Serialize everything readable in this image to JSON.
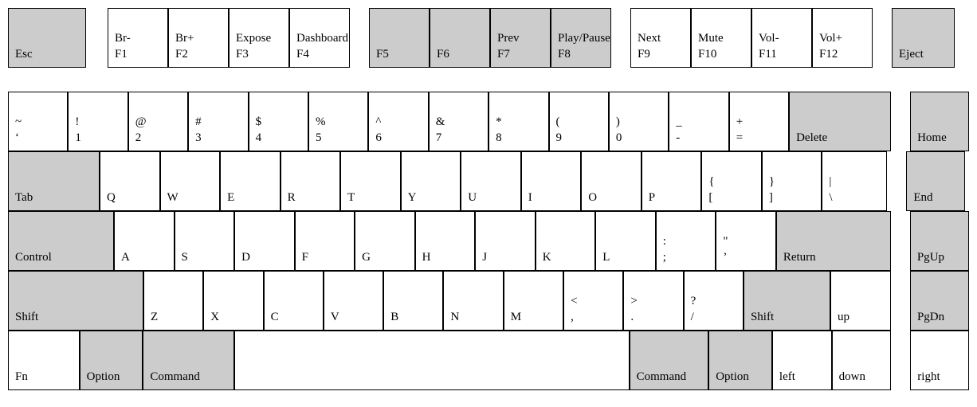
{
  "functionRow": {
    "esc": "Esc",
    "keys": [
      {
        "top": "Br-",
        "bottom": "F1",
        "shaded": false
      },
      {
        "top": "Br+",
        "bottom": "F2",
        "shaded": false
      },
      {
        "top": "Expose",
        "bottom": "F3",
        "shaded": false
      },
      {
        "top": "Dashboard",
        "bottom": "F4",
        "shaded": false
      },
      {
        "top": "",
        "bottom": "F5",
        "shaded": true
      },
      {
        "top": "",
        "bottom": "F6",
        "shaded": true
      },
      {
        "top": "Prev",
        "bottom": "F7",
        "shaded": true
      },
      {
        "top": "Play/Pause",
        "bottom": "F8",
        "shaded": true
      },
      {
        "top": "Next",
        "bottom": "F9",
        "shaded": false
      },
      {
        "top": "Mute",
        "bottom": "F10",
        "shaded": false
      },
      {
        "top": "Vol-",
        "bottom": "F11",
        "shaded": false
      },
      {
        "top": "Vol+",
        "bottom": "F12",
        "shaded": false
      }
    ],
    "eject": "Eject"
  },
  "numberRow": {
    "keys": [
      {
        "top": "~",
        "bottom": "‘"
      },
      {
        "top": "!",
        "bottom": "1"
      },
      {
        "top": "@",
        "bottom": "2"
      },
      {
        "top": "#",
        "bottom": "3"
      },
      {
        "top": "$",
        "bottom": "4"
      },
      {
        "top": "%",
        "bottom": "5"
      },
      {
        "top": "^",
        "bottom": "6"
      },
      {
        "top": "&",
        "bottom": "7"
      },
      {
        "top": "*",
        "bottom": "8"
      },
      {
        "top": "(",
        "bottom": "9"
      },
      {
        "top": ")",
        "bottom": "0"
      },
      {
        "top": "_",
        "bottom": "-"
      },
      {
        "top": "+",
        "bottom": "="
      }
    ],
    "delete": "Delete",
    "nav": "Home"
  },
  "qRow": {
    "tab": "Tab",
    "keys": [
      "Q",
      "W",
      "E",
      "R",
      "T",
      "Y",
      "U",
      "I",
      "O",
      "P"
    ],
    "brackets": [
      {
        "top": "{",
        "bottom": "["
      },
      {
        "top": "}",
        "bottom": "]"
      },
      {
        "top": "|",
        "bottom": "\\"
      }
    ],
    "nav": "End"
  },
  "aRow": {
    "control": "Control",
    "keys": [
      "A",
      "S",
      "D",
      "F",
      "G",
      "H",
      "J",
      "K",
      "L"
    ],
    "punct": [
      {
        "top": ":",
        "bottom": ";"
      },
      {
        "top": "\"",
        "bottom": "’"
      }
    ],
    "ret": "Return",
    "nav": "PgUp"
  },
  "zRow": {
    "shiftL": "Shift",
    "keys": [
      "Z",
      "X",
      "C",
      "V",
      "B",
      "N",
      "M"
    ],
    "punct": [
      {
        "top": "<",
        "bottom": ","
      },
      {
        "top": ">",
        "bottom": "."
      },
      {
        "top": "?",
        "bottom": "/"
      }
    ],
    "shiftR": "Shift",
    "up": "up",
    "nav": "PgDn"
  },
  "bottomRow": {
    "fn": "Fn",
    "optionL": "Option",
    "commandL": "Command",
    "commandR": "Command",
    "optionR": "Option",
    "left": "left",
    "down": "down",
    "right": "right"
  }
}
